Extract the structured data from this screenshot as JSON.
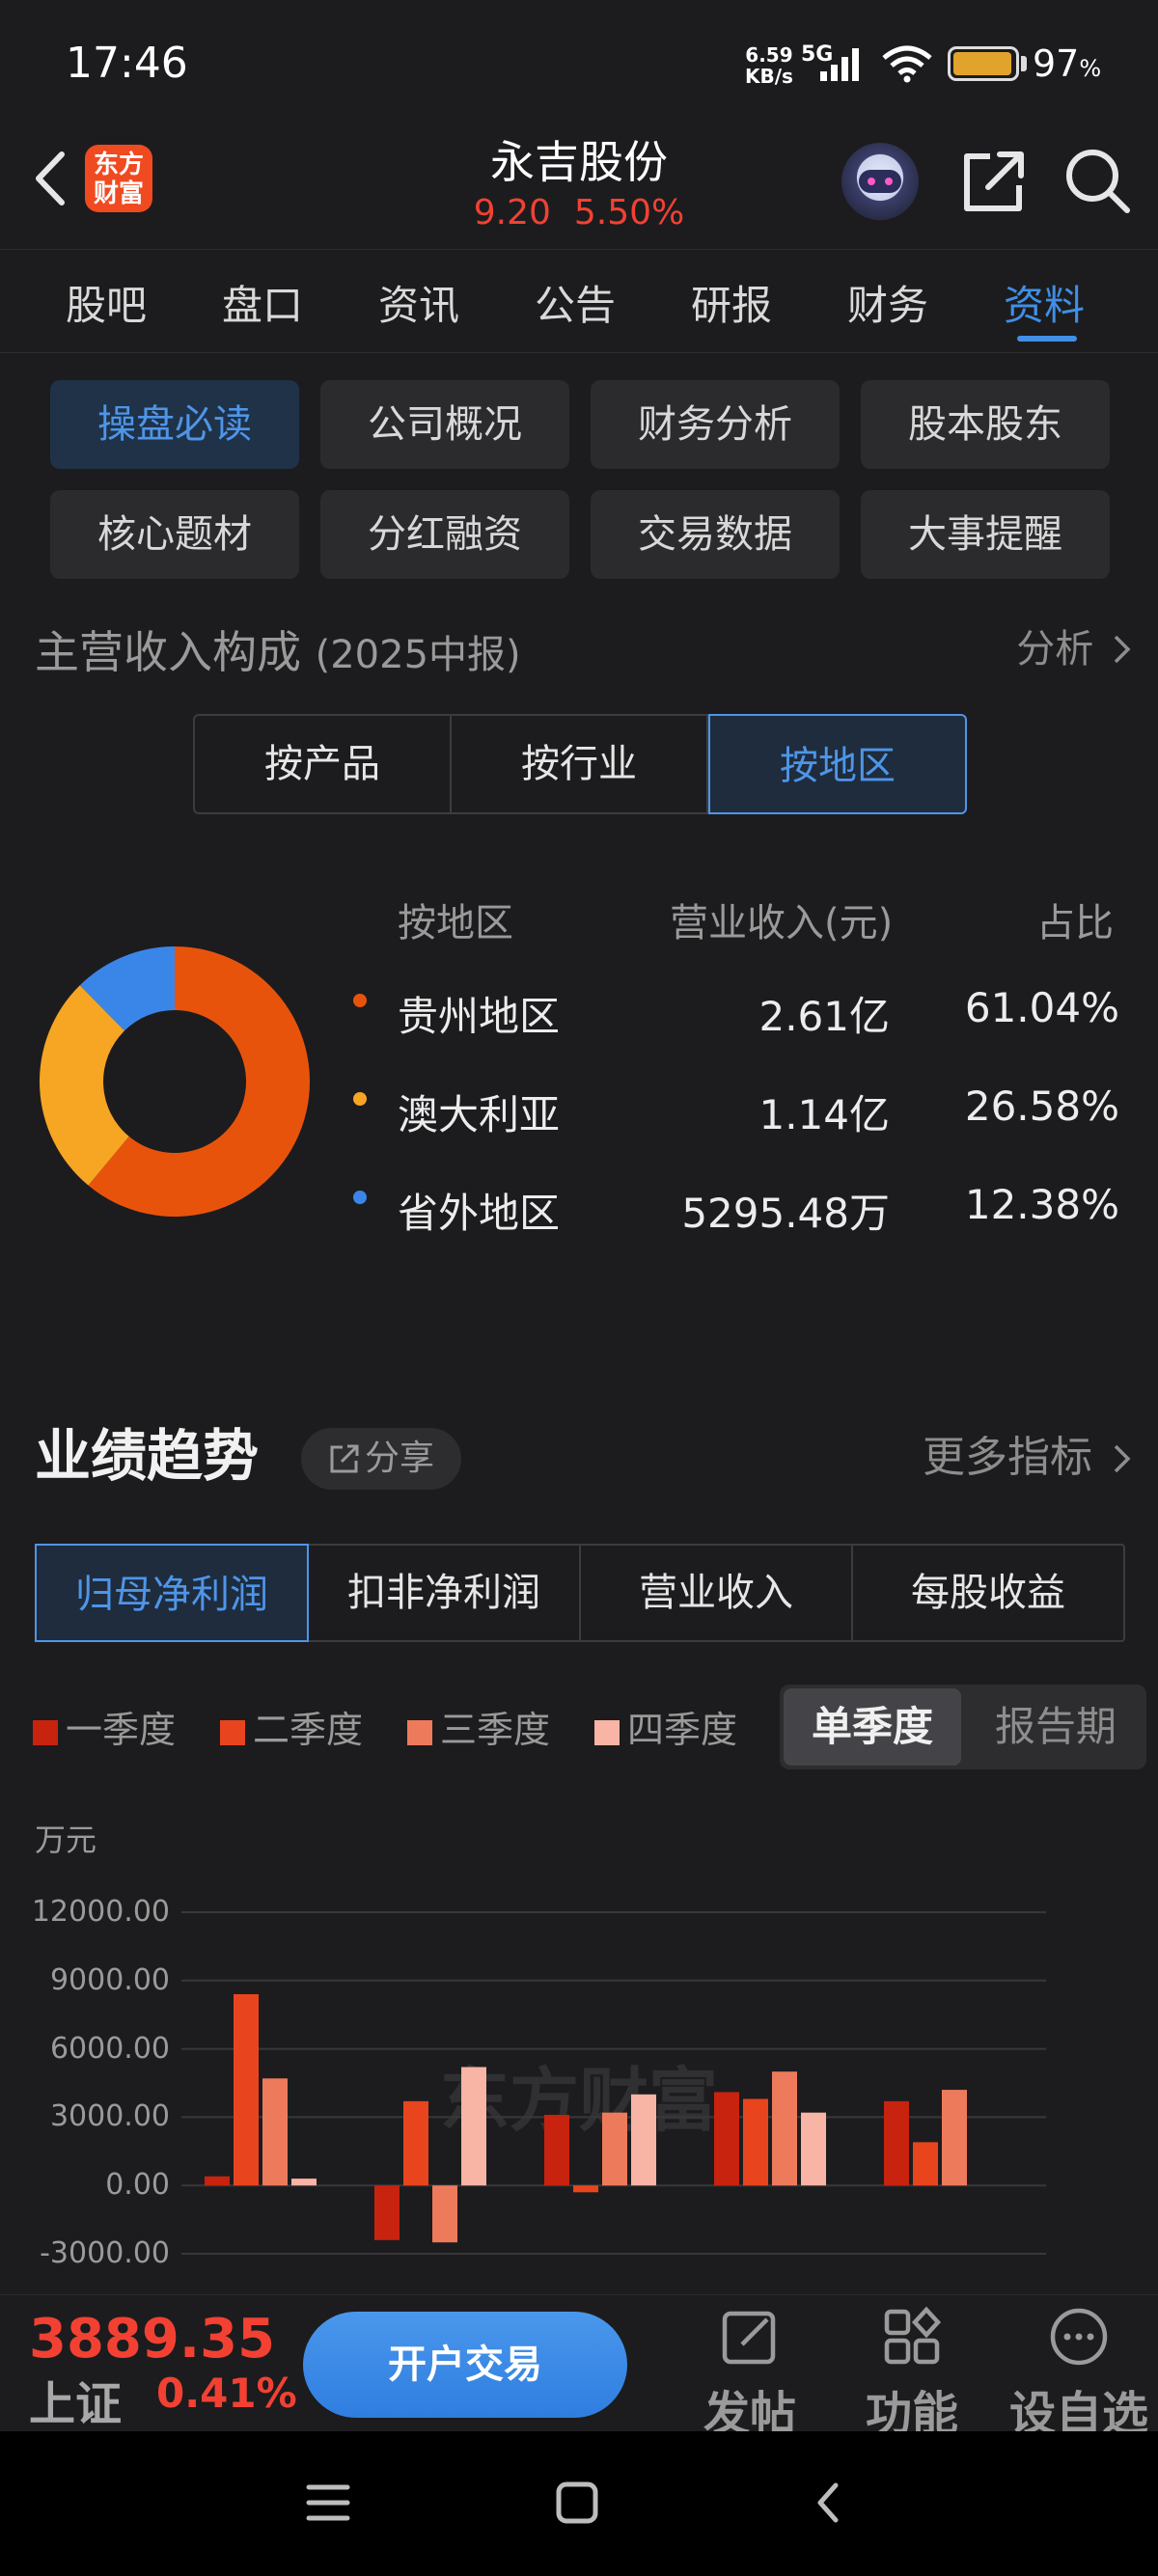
{
  "status_bar": {
    "time": "17:46",
    "net_speed_value": "6.59",
    "net_speed_unit": "KB/s",
    "network": "5G",
    "battery_level": 0.97,
    "battery_pct": "97",
    "battery_unit": "%"
  },
  "header": {
    "logo_line1": "东方",
    "logo_line2": "财富",
    "title": "永吉股份",
    "price": "9.20",
    "change_pct": "5.50%"
  },
  "tabs": [
    "股吧",
    "盘口",
    "资讯",
    "公告",
    "研报",
    "财务",
    "资料"
  ],
  "active_tab": "资料",
  "quick_buttons": [
    "操盘必读",
    "公司概况",
    "财务分析",
    "股本股东",
    "核心题材",
    "分红融资",
    "交易数据",
    "大事提醒"
  ],
  "revenue_section": {
    "title": "主营收入构成",
    "period": "(2025中报)",
    "more_label": "分析",
    "segments": [
      "按产品",
      "按行业",
      "按地区"
    ],
    "active_segment": "按地区",
    "table_headers": [
      "按地区",
      "营业收入(元)",
      "占比"
    ],
    "rows": [
      {
        "name": "贵州地区",
        "revenue": "2.61亿",
        "share": "61.04%",
        "pct": 61.04,
        "color": "#e8530c"
      },
      {
        "name": "澳大利亚",
        "revenue": "1.14亿",
        "share": "26.58%",
        "pct": 26.58,
        "color": "#f6a623"
      },
      {
        "name": "省外地区",
        "revenue": "5295.48万",
        "share": "12.38%",
        "pct": 12.38,
        "color": "#3a86e8"
      }
    ]
  },
  "performance_section": {
    "title": "业绩趋势",
    "share_label": "分享",
    "more_label": "更多指标",
    "metrics": [
      "归母净利润",
      "扣非净利润",
      "营业收入",
      "每股收益"
    ],
    "active_metric": "归母净利润",
    "legend": [
      "一季度",
      "二季度",
      "三季度",
      "四季度"
    ],
    "toggle": [
      "单季度",
      "报告期"
    ],
    "active_toggle": "单季度",
    "watermark": "东方财富"
  },
  "chart_data": {
    "type": "bar",
    "ylabel": "万元",
    "ylim": [
      -3000,
      12000
    ],
    "yticks": [
      "12000.00",
      "9000.00",
      "6000.00",
      "3000.00",
      "0.00",
      "-3000.00"
    ],
    "ytick_values": [
      12000,
      9000,
      6000,
      3000,
      0,
      -3000
    ],
    "grid": true,
    "series": [
      {
        "name": "一季度",
        "color": "#c8230f",
        "values": [
          400,
          -2400,
          3100,
          4100,
          3700
        ]
      },
      {
        "name": "二季度",
        "color": "#e8451e",
        "values": [
          8400,
          3700,
          -300,
          3800,
          1900
        ]
      },
      {
        "name": "三季度",
        "color": "#ee7a5c",
        "values": [
          4700,
          -2500,
          3200,
          5000,
          4200
        ]
      },
      {
        "name": "四季度",
        "color": "#f8b4a4",
        "values": [
          300,
          5200,
          4000,
          3200,
          null
        ]
      }
    ]
  },
  "bottom_bar": {
    "index_value": "3889.35",
    "index_name": "上证",
    "index_change": "0.41%",
    "trade_button": "开户交易",
    "items": [
      {
        "label": "发帖",
        "icon": "edit-icon"
      },
      {
        "label": "功能",
        "icon": "grid-icon"
      },
      {
        "label": "设自选",
        "icon": "more-icon"
      }
    ]
  }
}
